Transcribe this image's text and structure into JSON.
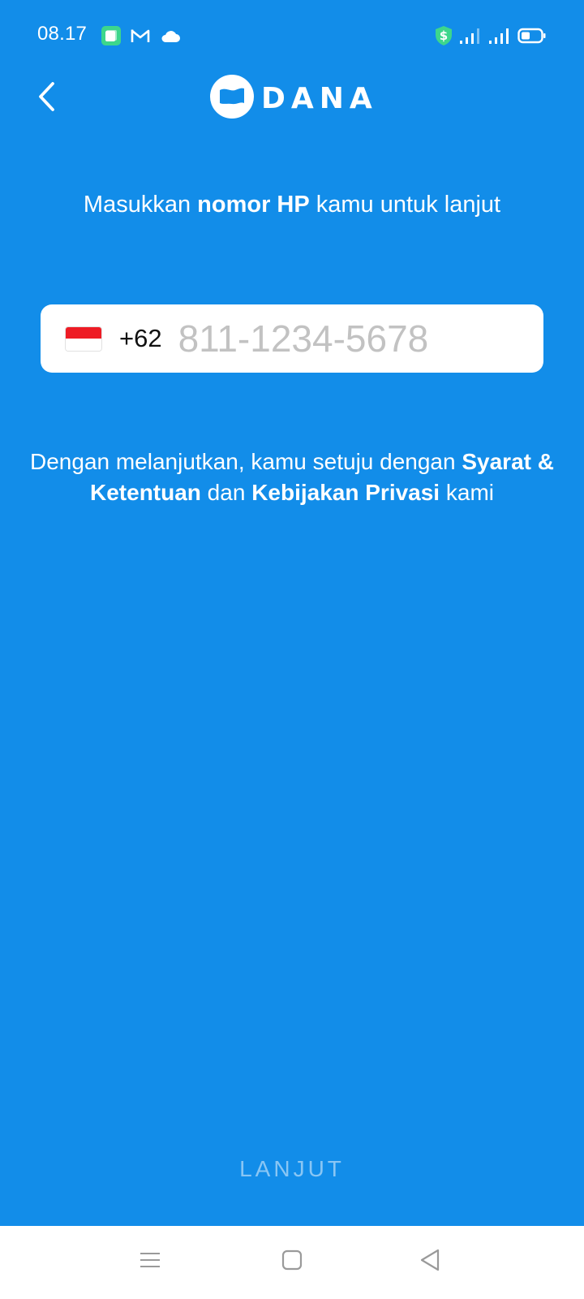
{
  "status_bar": {
    "time": "08.17",
    "left_icons": [
      "app-notification-icon",
      "gmail-icon",
      "cloud-icon"
    ],
    "right_icons": [
      "shield-dollar-icon",
      "signal-1-icon",
      "signal-2-icon",
      "battery-icon"
    ]
  },
  "header": {
    "brand_name": "DANA",
    "back_icon": "chevron-left-icon"
  },
  "prompt": {
    "pre": "Masukkan ",
    "bold": "nomor HP",
    "post": " kamu untuk lanjut"
  },
  "phone_field": {
    "flag": "indonesia-flag",
    "country_code": "+62",
    "value": "",
    "placeholder": "811-1234-5678"
  },
  "terms": {
    "pre": "Dengan melanjutkan, kamu setuju dengan ",
    "link_terms": "Syarat & Ketentuan",
    "mid": " dan ",
    "link_privacy": "Kebijakan Privasi",
    "post": " kami"
  },
  "submit": {
    "label": "LANJUT"
  },
  "nav_bar": {
    "items": [
      "menu-icon",
      "home-icon",
      "back-triangle-icon"
    ]
  },
  "colors": {
    "background": "#128DE9",
    "field_background": "#FFFFFF",
    "placeholder": "#C2C2C2",
    "flag_red": "#EE1C25",
    "status_green": "#3DD68C"
  }
}
